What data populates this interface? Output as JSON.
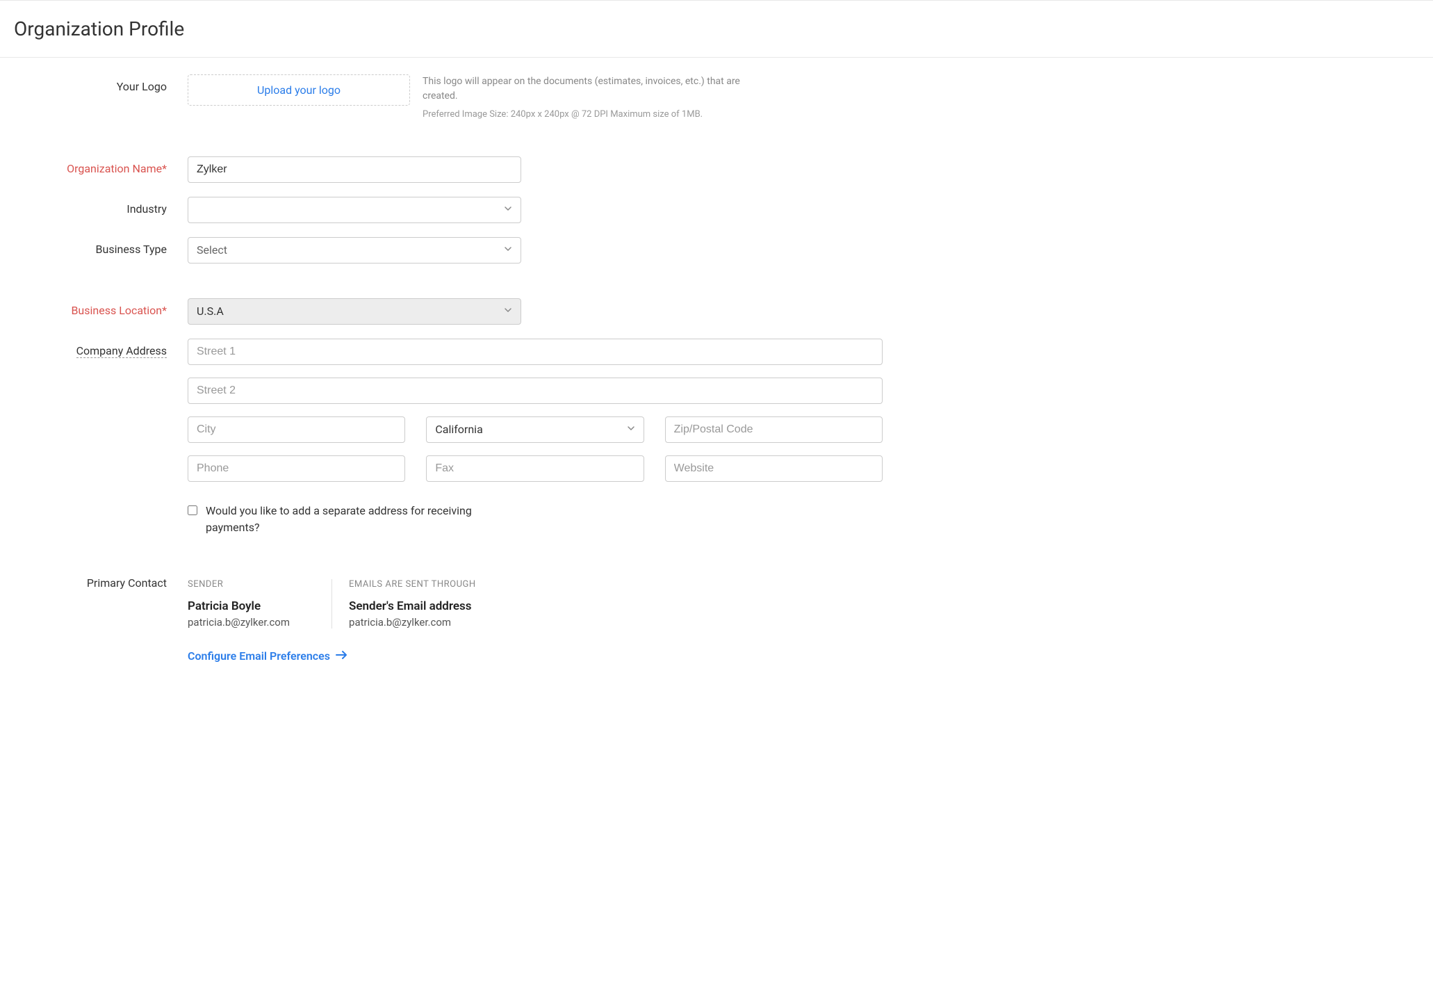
{
  "page": {
    "title": "Organization Profile"
  },
  "labels": {
    "your_logo": "Your Logo",
    "organization_name": "Organization Name*",
    "industry": "Industry",
    "business_type": "Business Type",
    "business_location": "Business Location*",
    "company_address": "Company Address",
    "primary_contact": "Primary Contact"
  },
  "logo": {
    "upload_text": "Upload your logo",
    "help_text": "This logo will appear on the documents (estimates, invoices, etc.) that are created.",
    "help_sub": "Preferred Image Size: 240px x 240px @ 72 DPI Maximum size of 1MB."
  },
  "fields": {
    "organization_name": "Zylker",
    "industry": "",
    "business_type_placeholder": "Select",
    "business_location": "U.S.A",
    "street1_placeholder": "Street 1",
    "street2_placeholder": "Street 2",
    "city_placeholder": "City",
    "state": "California",
    "zip_placeholder": "Zip/Postal Code",
    "phone_placeholder": "Phone",
    "fax_placeholder": "Fax",
    "website_placeholder": "Website"
  },
  "checkbox": {
    "separate_address_label": "Would you like to add a separate address for receiving payments?"
  },
  "contact": {
    "sender_header": "SENDER",
    "sender_name": "Patricia Boyle",
    "sender_email": "patricia.b@zylker.com",
    "through_header": "EMAILS ARE SENT THROUGH",
    "through_name": "Sender's Email address",
    "through_email": "patricia.b@zylker.com"
  },
  "links": {
    "configure_email": "Configure Email Preferences"
  }
}
